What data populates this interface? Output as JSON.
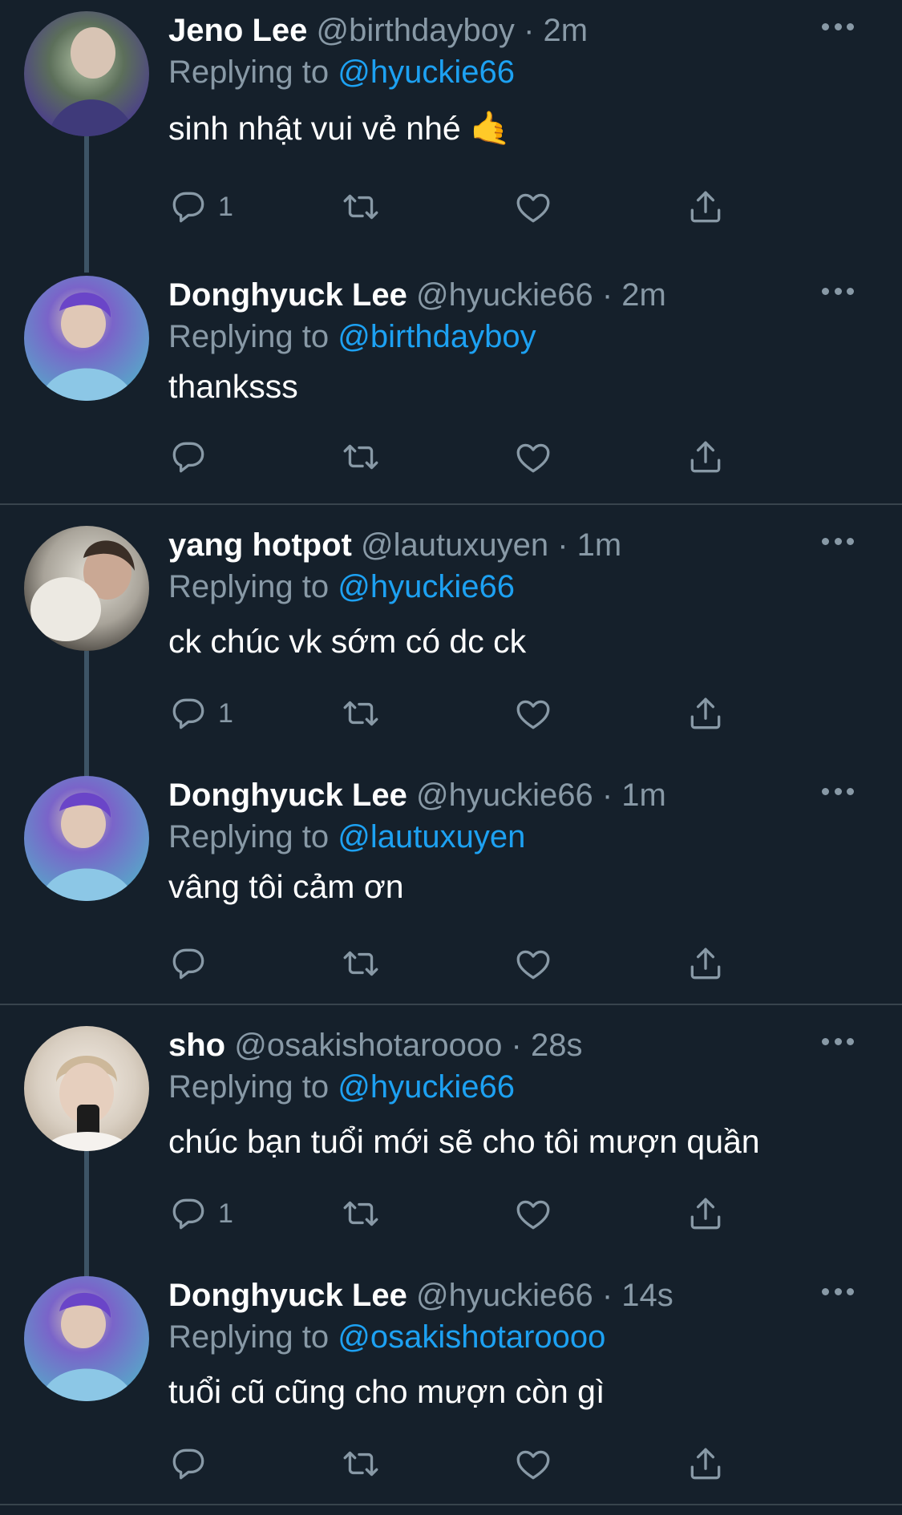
{
  "colors": {
    "background": "#15202b",
    "text_primary": "#ffffff",
    "text_secondary": "#8899a6",
    "accent": "#1da1f2",
    "divider": "#38444d"
  },
  "action_icons": [
    "reply-icon",
    "retweet-icon",
    "like-icon",
    "share-icon"
  ],
  "tweets": [
    {
      "name": "Jeno Lee",
      "handle": "@birthdayboy",
      "time": "· 2m",
      "replying_label": "Replying to",
      "replying_to": "@hyuckie66",
      "text": "sinh nhật vui vẻ nhé 🤙",
      "reply_count": "1"
    },
    {
      "name": "Donghyuck Lee",
      "handle": "@hyuckie66",
      "time": "· 2m",
      "replying_label": "Replying to",
      "replying_to": "@birthdayboy",
      "text": "thanksss",
      "reply_count": ""
    },
    {
      "name": "yang hotpot",
      "handle": "@lautuxuyen",
      "time": "· 1m",
      "replying_label": "Replying to",
      "replying_to": "@hyuckie66",
      "text": "ck chúc vk sớm có dc ck",
      "reply_count": "1"
    },
    {
      "name": "Donghyuck Lee",
      "handle": "@hyuckie66",
      "time": "· 1m",
      "replying_label": "Replying to",
      "replying_to": "@lautuxuyen",
      "text": "vâng tôi cảm ơn",
      "reply_count": ""
    },
    {
      "name": "sho",
      "handle": "@osakishotaroooo",
      "time": "· 28s",
      "replying_label": "Replying to",
      "replying_to": "@hyuckie66",
      "text": "chúc bạn tuổi mới sẽ cho tôi mượn quần",
      "reply_count": "1"
    },
    {
      "name": "Donghyuck Lee",
      "handle": "@hyuckie66",
      "time": "· 14s",
      "replying_label": "Replying to",
      "replying_to": "@osakishotaroooo",
      "text": "tuổi cũ cũng cho mượn còn gì",
      "reply_count": ""
    }
  ]
}
